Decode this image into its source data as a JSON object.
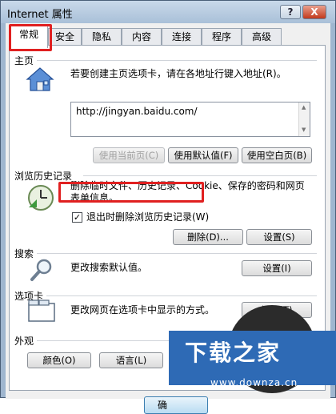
{
  "window": {
    "title": "Internet 属性",
    "help": "?",
    "close": "X"
  },
  "tabs": [
    "常规",
    "安全",
    "隐私",
    "内容",
    "连接",
    "程序",
    "高级"
  ],
  "homepage": {
    "label": "主页",
    "desc": "若要创建主页选项卡，请在各地址行键入地址(R)。",
    "url": "http://jingyan.baidu.com/",
    "btn_current": "使用当前页(C)",
    "btn_default": "使用默认值(F)",
    "btn_blank": "使用空白页(B)"
  },
  "history": {
    "label": "浏览历史记录",
    "desc": "删除临时文件、历史记录、Cookie、保存的密码和网页表单信息。",
    "checkbox_label": "退出时删除浏览历史记录(W)",
    "checkbox_checked": true,
    "btn_delete": "删除(D)...",
    "btn_settings": "设置(S)"
  },
  "search": {
    "label": "搜索",
    "desc": "更改搜索默认值。",
    "btn_settings": "设置(I)"
  },
  "tabs_section": {
    "label": "选项卡",
    "desc": "更改网页在选项卡中显示的方式。",
    "btn_settings": "设置(T)"
  },
  "appearance": {
    "label": "外观",
    "btn_colors": "颜色(O)",
    "btn_languages": "语言(L)"
  },
  "footer": {
    "ok": "确"
  },
  "watermark": {
    "brand": "下载之家",
    "url": "www.downza.cn"
  }
}
